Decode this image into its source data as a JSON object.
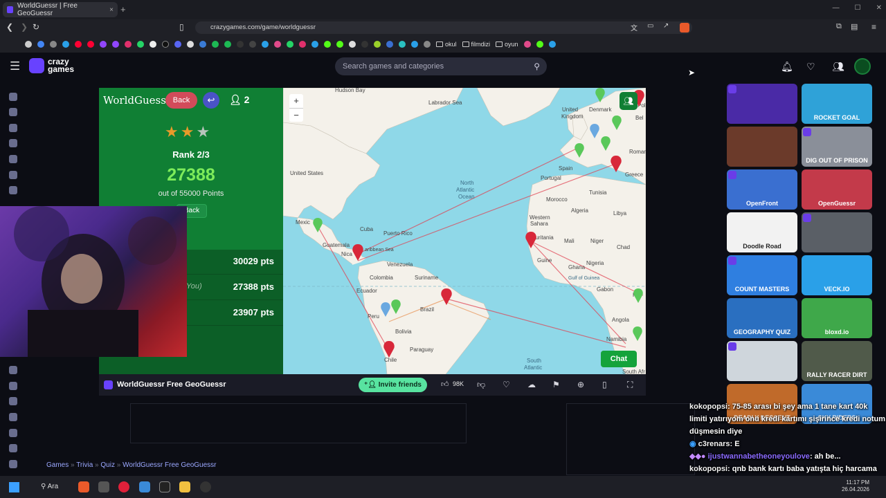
{
  "browser": {
    "tab_title": "WorldGuessr | Free GeoGuessr",
    "new_tab_icon": "+",
    "url": "crazygames.com/game/worldguessr",
    "bookmark_folders": [
      "okul",
      "filmdizi",
      "oyun"
    ]
  },
  "site": {
    "logo_line1": "crazy",
    "logo_line2": "games",
    "search_placeholder": "Search games and categories"
  },
  "game": {
    "title": "WorldGuessr",
    "back_label": "Back",
    "players_count": "2",
    "stars_filled": 2,
    "stars_total": 3,
    "rank": "Rank 2/3",
    "score": "27388",
    "out_of": "out of 55000 Points",
    "back2_label": "Back",
    "leaderboard": [
      {
        "name": "",
        "points": "30029 pts"
      },
      {
        "name": "You)",
        "points": "27388 pts"
      },
      {
        "name": "",
        "points": "23907 pts"
      }
    ],
    "chat_label": "Chat"
  },
  "map_labels": {
    "hudson": "Hudson Bay",
    "labrador": "Labrador Sea",
    "us": "United States",
    "mexico": "Mexic",
    "cuba": "Cuba",
    "pr": "Puerto Rico",
    "guatemala": "Guatemala",
    "nicaragua": "Nica",
    "caribbean": "aribbean Sea",
    "venezuela": "Venezuela",
    "colombia": "Colombia",
    "suriname": "Suriname",
    "ecuador": "Ecuador",
    "brazil": "Brazil",
    "peru": "Peru",
    "bolivia": "Bolivia",
    "paraguay": "Paraguay",
    "chile": "Chile",
    "natl1": "North",
    "natl2": "Atlantic",
    "natl3": "Ocean",
    "satl1": "South",
    "satl2": "Atlantic",
    "spain": "Spain",
    "portugal": "Portugal",
    "tunisia": "Tunisia",
    "morocco": "Morocco",
    "algeria": "Algeria",
    "libya": "Libya",
    "ws1": "Western",
    "ws2": "Sahara",
    "mauritania": "auritania",
    "mali": "Mali",
    "niger": "Niger",
    "chad": "Chad",
    "nigeria": "Nigeria",
    "ghana": "Ghana",
    "guinea": "Guine",
    "gulf": "Gulf of Guinea",
    "gabon": "Gabon",
    "angola": "Angola",
    "namibia": "Namibia",
    "southafr": "South Afr",
    "greece": "Greece",
    "denmark": "Denmark",
    "uk1": "United",
    "uk2": "Kingdom",
    "roman": "Roman",
    "bel": "Bel",
    "rc": "RC",
    "pol": "Pol"
  },
  "game_footer": {
    "title": "WorldGuessr Free GeoGuessr",
    "invite_label": "Invite friends",
    "likes": "98K"
  },
  "breadcrumb": [
    "Games",
    "Trivia",
    "Quiz",
    "WorldGuessr Free GeoGuessr"
  ],
  "right_games": [
    {
      "label": "",
      "color": "#4a2aa6"
    },
    {
      "label": "ROCKET GOAL",
      "color": "#2fa2d8"
    },
    {
      "label": "",
      "color": "#6b3a2a"
    },
    {
      "label": "DIG OUT OF PRISON",
      "color": "#8a8f99"
    },
    {
      "label": "OpenFront",
      "color": "#3a6fd0"
    },
    {
      "label": "OpenGuessr",
      "color": "#c33a4a"
    },
    {
      "label": "Doodle Road",
      "color": "#f2f2f2"
    },
    {
      "label": "",
      "color": "#5a5f66"
    },
    {
      "label": "COUNT MASTERS",
      "color": "#2f7fe0"
    },
    {
      "label": "VECK.IO",
      "color": "#2aa0e8"
    },
    {
      "label": "GEOGRAPHY QUIZ",
      "color": "#2a6fc0"
    },
    {
      "label": "bloxd.io",
      "color": "#3fa84a"
    },
    {
      "label": "",
      "color": "#cfd6dc"
    },
    {
      "label": "RALLY RACER DIRT",
      "color": "#505a4a"
    },
    {
      "label": "DEADLY DESCENT",
      "color": "#c06a2a"
    },
    {
      "label": "SKY RIDERS",
      "color": "#3a8ad8"
    }
  ],
  "stream_chat": [
    {
      "user": "kokopopsi",
      "text": ": 75-85 arası bi şey ama 1 tane kart 40k limiti yatırıyom onu kredi kartımı şişirince kredi notum düşmesin diye"
    },
    {
      "user": "c3renars",
      "text": ": E"
    },
    {
      "user": "ijustwannabetheoneyoulove",
      "text": ": ah be..."
    },
    {
      "user": "kokopopsi",
      "text": ": qnb bank kartı baba yatışta hiç harcama yapmadım"
    }
  ],
  "taskbar": {
    "search_label": "Ara",
    "time": "11:17 PM",
    "date": "26.04.2026"
  },
  "colors": {
    "accent": "#6842ff",
    "game_green": "#107f34",
    "score_green": "#7dec5a",
    "invite": "#58e3a0",
    "route": "#e04050",
    "route_orange": "#e89050"
  }
}
